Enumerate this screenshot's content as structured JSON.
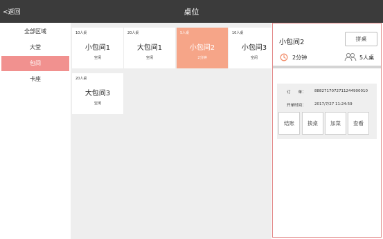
{
  "header": {
    "back_label": "<返回",
    "title": "桌位"
  },
  "sidebar": {
    "items": [
      {
        "label": "全部区域"
      },
      {
        "label": "大堂"
      },
      {
        "label": "包间"
      },
      {
        "label": "卡座"
      }
    ]
  },
  "tables": [
    {
      "capacity": "10人桌",
      "name": "小包间1",
      "status": "空闲"
    },
    {
      "capacity": "20人桌",
      "name": "大包间1",
      "status": "空闲"
    },
    {
      "capacity": "5人桌",
      "name": "小包间2",
      "status": "2分钟"
    },
    {
      "capacity": "10人桌",
      "name": "小包间3",
      "status": "空闲"
    },
    {
      "capacity": "20人桌",
      "name": "大包间3",
      "status": "空闲"
    }
  ],
  "detail": {
    "name": "小包间2",
    "share_label": "拼桌",
    "duration": "2分钟",
    "people": "5人桌",
    "order_label": "订　　单：",
    "order_value": "8882717072711244900010",
    "open_time_label": "开单时间：",
    "open_time_value": "2017/7/27 11:24:59",
    "actions": [
      "结账",
      "换桌",
      "加菜",
      "查看"
    ]
  },
  "colors": {
    "header_bg": "#3b3b3b",
    "active_side": "#f1918f",
    "selected_card": "#f6a588",
    "panel_border": "#e38a8a",
    "clock_icon": "#f2906e"
  }
}
